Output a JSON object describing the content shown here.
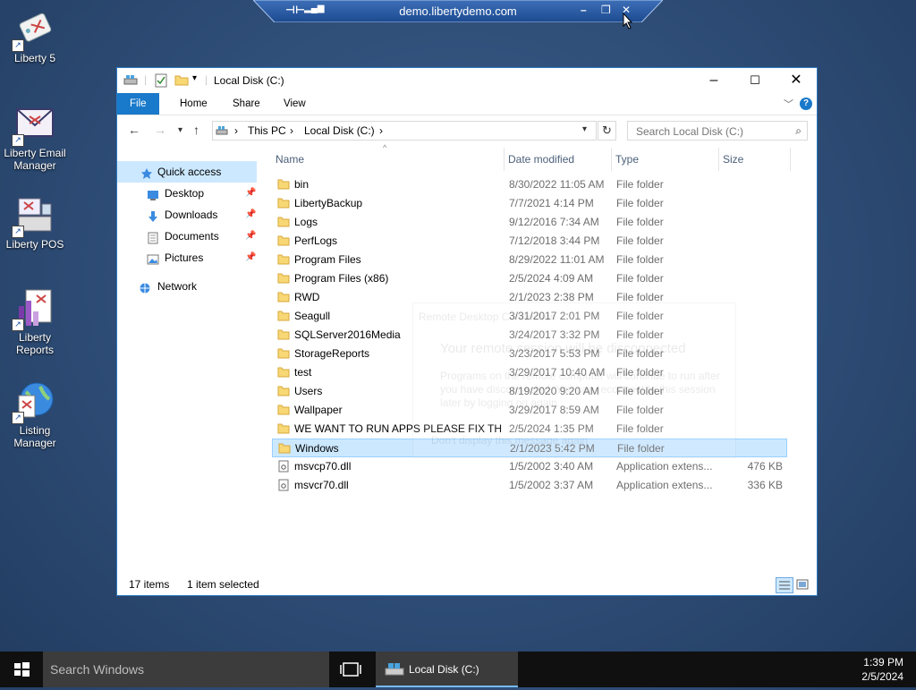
{
  "remote_bar": {
    "host": "demo.libertydemo.com"
  },
  "desktop_icons": [
    {
      "label": "Liberty 5"
    },
    {
      "label": "Liberty Email Manager"
    },
    {
      "label": "Liberty POS"
    },
    {
      "label": "Liberty Reports"
    },
    {
      "label": "Listing Manager"
    }
  ],
  "window": {
    "title": "Local Disk (C:)",
    "ribbon_tabs": [
      "File",
      "Home",
      "Share",
      "View"
    ],
    "address": {
      "crumbs": [
        "This PC",
        "Local Disk (C:)"
      ]
    },
    "search_placeholder": "Search Local Disk (C:)",
    "nav_pane": {
      "quick_access": "Quick access",
      "items": [
        "Desktop",
        "Downloads",
        "Documents",
        "Pictures"
      ],
      "network": "Network"
    },
    "columns": [
      "Name",
      "Date modified",
      "Type",
      "Size"
    ],
    "files": [
      {
        "name": "bin",
        "date": "8/30/2022 11:05 AM",
        "type": "File folder",
        "size": "",
        "kind": "folder"
      },
      {
        "name": "LibertyBackup",
        "date": "7/7/2021 4:14 PM",
        "type": "File folder",
        "size": "",
        "kind": "folder"
      },
      {
        "name": "Logs",
        "date": "9/12/2016 7:34 AM",
        "type": "File folder",
        "size": "",
        "kind": "folder"
      },
      {
        "name": "PerfLogs",
        "date": "7/12/2018 3:44 PM",
        "type": "File folder",
        "size": "",
        "kind": "folder"
      },
      {
        "name": "Program Files",
        "date": "8/29/2022 11:01 AM",
        "type": "File folder",
        "size": "",
        "kind": "folder"
      },
      {
        "name": "Program Files (x86)",
        "date": "2/5/2024 4:09 AM",
        "type": "File folder",
        "size": "",
        "kind": "folder"
      },
      {
        "name": "RWD",
        "date": "2/1/2023 2:38 PM",
        "type": "File folder",
        "size": "",
        "kind": "folder"
      },
      {
        "name": "Seagull",
        "date": "3/31/2017 2:01 PM",
        "type": "File folder",
        "size": "",
        "kind": "folder"
      },
      {
        "name": "SQLServer2016Media",
        "date": "3/24/2017 3:32 PM",
        "type": "File folder",
        "size": "",
        "kind": "folder"
      },
      {
        "name": "StorageReports",
        "date": "3/23/2017 5:53 PM",
        "type": "File folder",
        "size": "",
        "kind": "folder"
      },
      {
        "name": "test",
        "date": "3/29/2017 10:40 AM",
        "type": "File folder",
        "size": "",
        "kind": "folder"
      },
      {
        "name": "Users",
        "date": "8/19/2020 9:20 AM",
        "type": "File folder",
        "size": "",
        "kind": "folder"
      },
      {
        "name": "Wallpaper",
        "date": "3/29/2017 8:59 AM",
        "type": "File folder",
        "size": "",
        "kind": "folder"
      },
      {
        "name": "WE WANT TO RUN APPS PLEASE FIX THE...",
        "date": "2/5/2024 1:35 PM",
        "type": "File folder",
        "size": "",
        "kind": "folder"
      },
      {
        "name": "Windows",
        "date": "2/1/2023 5:42 PM",
        "type": "File folder",
        "size": "",
        "kind": "folder",
        "selected": true
      },
      {
        "name": "msvcp70.dll",
        "date": "1/5/2002 3:40 AM",
        "type": "Application extens...",
        "size": "476 KB",
        "kind": "dll"
      },
      {
        "name": "msvcr70.dll",
        "date": "1/5/2002 3:37 AM",
        "type": "Application extens...",
        "size": "336 KB",
        "kind": "dll"
      }
    ],
    "status": {
      "count": "17 items",
      "selection": "1 item selected"
    }
  },
  "ghost_dialog": {
    "lines": [
      "Remote Desktop Connection",
      "Your remote session will be disconnected",
      "Programs on the remote computer will continue to run after",
      "you have disconnected. You can reconnect to this session",
      "later by logging on again.",
      "Don't display this message again"
    ]
  },
  "taskbar": {
    "search_placeholder": "Search Windows",
    "app_label": "Local Disk (C:)",
    "time": "1:39 PM",
    "date": "2/5/2024"
  },
  "colors": {
    "accent": "#1979ca",
    "selection": "#cce8ff",
    "folder": "#f8d775",
    "taskbar": "#101010"
  }
}
